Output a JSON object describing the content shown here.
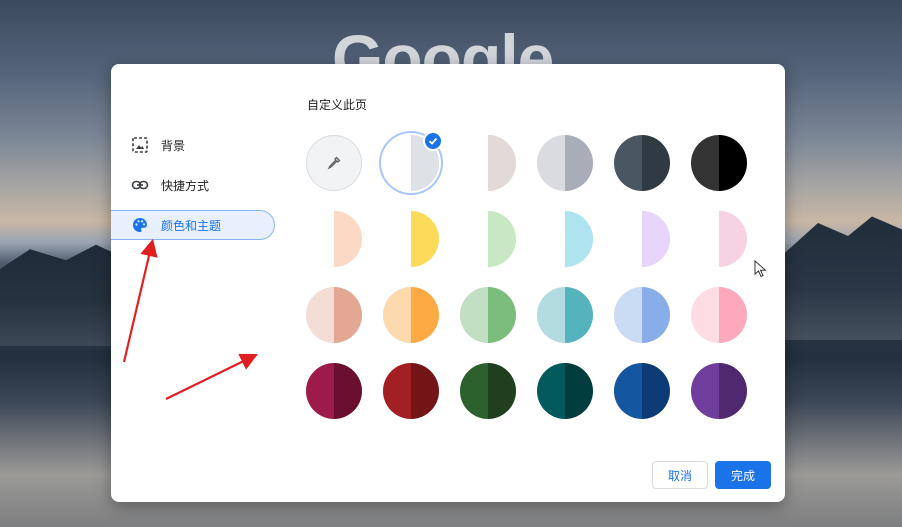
{
  "background": {
    "logo_text": "Google"
  },
  "dialog": {
    "title": "自定义此页",
    "nav": [
      {
        "label": "背景",
        "icon": "image-icon"
      },
      {
        "label": "快捷方式",
        "icon": "link-icon"
      },
      {
        "label": "颜色和主题",
        "icon": "palette-icon",
        "active": true
      }
    ],
    "buttons": {
      "cancel": "取消",
      "done": "完成"
    },
    "colors": {
      "accent": "#1a73e8",
      "rows": [
        [
          {
            "type": "custom",
            "icon": "eyedropper-icon"
          },
          {
            "l": "#ffffff",
            "r": "#dee1e6",
            "selected": true
          },
          {
            "l": "#ffffff",
            "r": "#e3d9d7"
          },
          {
            "l": "#d9dbe0",
            "r": "#a9adb8"
          },
          {
            "l": "#4a5661",
            "r": "#2f3a42"
          },
          {
            "l": "#333333",
            "r": "#000000"
          }
        ],
        [
          {
            "l": "#ffffff",
            "r": "#fcd9c5"
          },
          {
            "l": "#ffffff",
            "r": "#fddb5a"
          },
          {
            "l": "#ffffff",
            "r": "#c7e8c2"
          },
          {
            "l": "#ffffff",
            "r": "#aee3f0"
          },
          {
            "l": "#ffffff",
            "r": "#e6d4fb"
          },
          {
            "l": "#ffffff",
            "r": "#f6d2e2"
          }
        ],
        [
          {
            "l": "#f3ddd5",
            "r": "#e3a894"
          },
          {
            "l": "#fdd9ae",
            "r": "#fdaa44"
          },
          {
            "l": "#c2dfc3",
            "r": "#7bbd7c"
          },
          {
            "l": "#b3dce1",
            "r": "#55b3bd"
          },
          {
            "l": "#cadcf4",
            "r": "#89ade8"
          },
          {
            "l": "#fddde3",
            "r": "#fcaabb"
          }
        ],
        [
          {
            "l": "#9c1b4a",
            "r": "#6b0f30"
          },
          {
            "l": "#a21f24",
            "r": "#731416"
          },
          {
            "l": "#2c612d",
            "r": "#1f3f1f"
          },
          {
            "l": "#035a5d",
            "r": "#013c3e"
          },
          {
            "l": "#1456a0",
            "r": "#0c3b75"
          },
          {
            "l": "#6f3d9b",
            "r": "#4f2870"
          }
        ]
      ]
    }
  }
}
